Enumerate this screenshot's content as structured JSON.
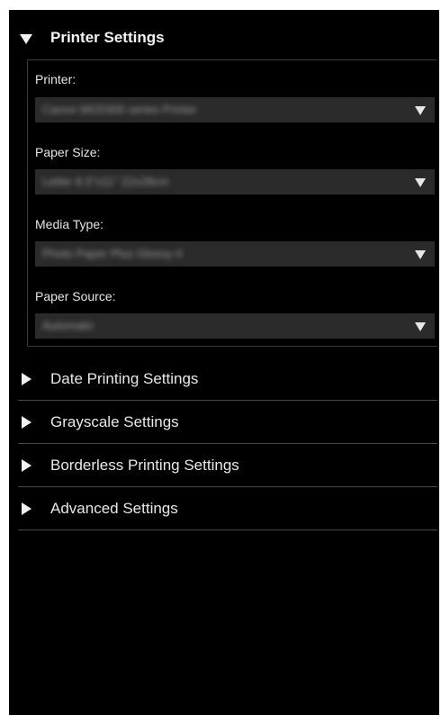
{
  "printer_settings": {
    "title": "Printer Settings",
    "fields": [
      {
        "label": "Printer:",
        "value": "Canon MG5300 series Printer"
      },
      {
        "label": "Paper Size:",
        "value": "Letter 8.5\"x11\" 22x28cm"
      },
      {
        "label": "Media Type:",
        "value": "Photo Paper Plus Glossy II"
      },
      {
        "label": "Paper Source:",
        "value": "Automatic"
      }
    ]
  },
  "sections": [
    {
      "label": "Date Printing Settings"
    },
    {
      "label": "Grayscale Settings"
    },
    {
      "label": "Borderless Printing Settings"
    },
    {
      "label": "Advanced Settings"
    }
  ]
}
